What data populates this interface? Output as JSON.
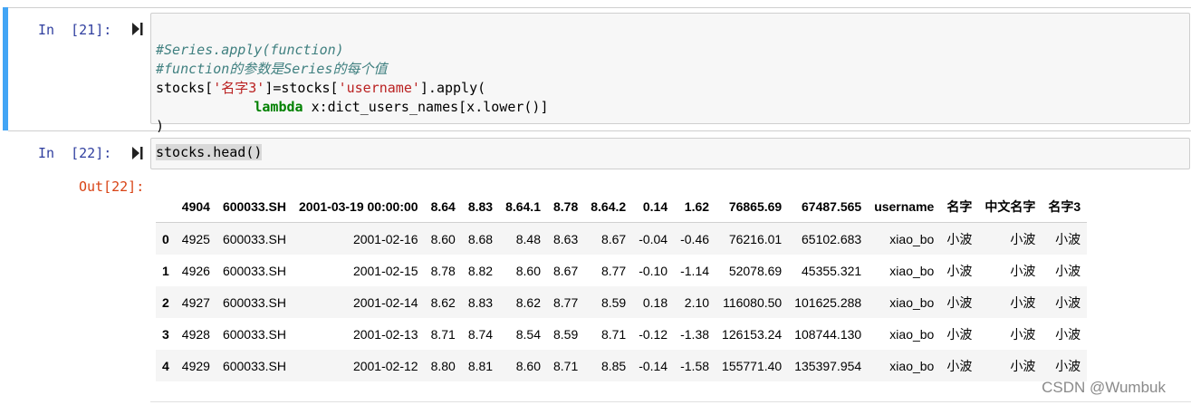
{
  "cells": [
    {
      "prompt": "In  [21]:",
      "code": {
        "comment1": "#Series.apply(function)",
        "comment2": "#function的参数是Series的每个值",
        "line3_a": "stocks[",
        "line3_s1": "'名字3'",
        "line3_b": "]=stocks[",
        "line3_s2": "'username'",
        "line3_c": "].apply(",
        "line4_indent": "            ",
        "line4_kw": "lambda",
        "line4_rest": " x:dict_users_names[x.lower()]",
        "line5": ")"
      }
    },
    {
      "prompt": "In  [22]:",
      "code": "stocks.head()",
      "out_prompt": "Out[22]:"
    }
  ],
  "dataframe": {
    "columns": [
      "",
      "4904",
      "600033.SH",
      "2001-03-19 00:00:00",
      "8.64",
      "8.83",
      "8.64.1",
      "8.78",
      "8.64.2",
      "0.14",
      "1.62",
      "76865.69",
      "67487.565",
      "username",
      "名字",
      "中文名字",
      "名字3"
    ],
    "rows": [
      [
        "0",
        "4925",
        "600033.SH",
        "2001-02-16",
        "8.60",
        "8.68",
        "8.48",
        "8.63",
        "8.67",
        "-0.04",
        "-0.46",
        "76216.01",
        "65102.683",
        "xiao_bo",
        "小波",
        "小波",
        "小波"
      ],
      [
        "1",
        "4926",
        "600033.SH",
        "2001-02-15",
        "8.78",
        "8.82",
        "8.60",
        "8.67",
        "8.77",
        "-0.10",
        "-1.14",
        "52078.69",
        "45355.321",
        "xiao_bo",
        "小波",
        "小波",
        "小波"
      ],
      [
        "2",
        "4927",
        "600033.SH",
        "2001-02-14",
        "8.62",
        "8.83",
        "8.62",
        "8.77",
        "8.59",
        "0.18",
        "2.10",
        "116080.50",
        "101625.288",
        "xiao_bo",
        "小波",
        "小波",
        "小波"
      ],
      [
        "3",
        "4928",
        "600033.SH",
        "2001-02-13",
        "8.71",
        "8.74",
        "8.54",
        "8.59",
        "8.71",
        "-0.12",
        "-1.38",
        "126153.24",
        "108744.130",
        "xiao_bo",
        "小波",
        "小波",
        "小波"
      ],
      [
        "4",
        "4929",
        "600033.SH",
        "2001-02-12",
        "8.80",
        "8.81",
        "8.60",
        "8.71",
        "8.85",
        "-0.14",
        "-1.58",
        "155771.40",
        "135397.954",
        "xiao_bo",
        "小波",
        "小波",
        "小波"
      ]
    ]
  },
  "watermark": "CSDN @Wumbuk",
  "icons": {
    "run": "run-cell-icon"
  },
  "colors": {
    "selected_bar": "#42a5f5",
    "in_prompt": "#303f9f",
    "out_prompt": "#d84315"
  }
}
